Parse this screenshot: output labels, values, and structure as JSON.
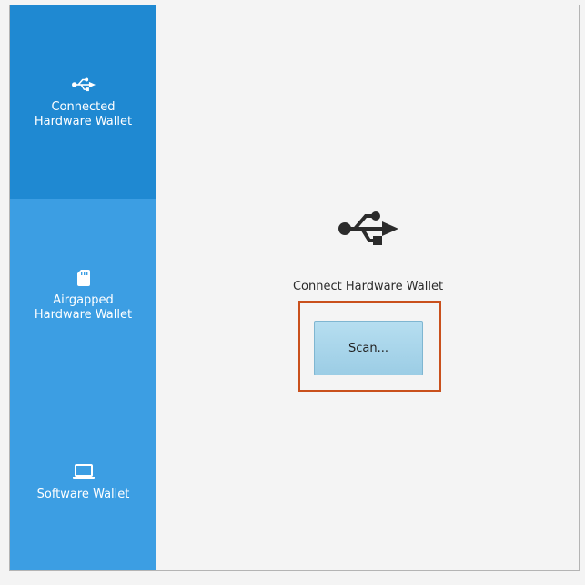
{
  "sidebar": {
    "items": [
      {
        "label": "Connected\nHardware Wallet",
        "icon": "usb-icon",
        "selected": true
      },
      {
        "label": "Airgapped\nHardware Wallet",
        "icon": "sd-card-icon",
        "selected": false
      },
      {
        "label": "Software Wallet",
        "icon": "laptop-icon",
        "selected": false
      }
    ]
  },
  "main": {
    "icon": "usb-icon",
    "heading": "Connect Hardware Wallet",
    "scan_label": "Scan..."
  },
  "colors": {
    "sidebar": "#3c9ee3",
    "sidebar_selected": "#1f89d2",
    "focus_border": "#c9501c",
    "button": "#a8d4ea"
  }
}
